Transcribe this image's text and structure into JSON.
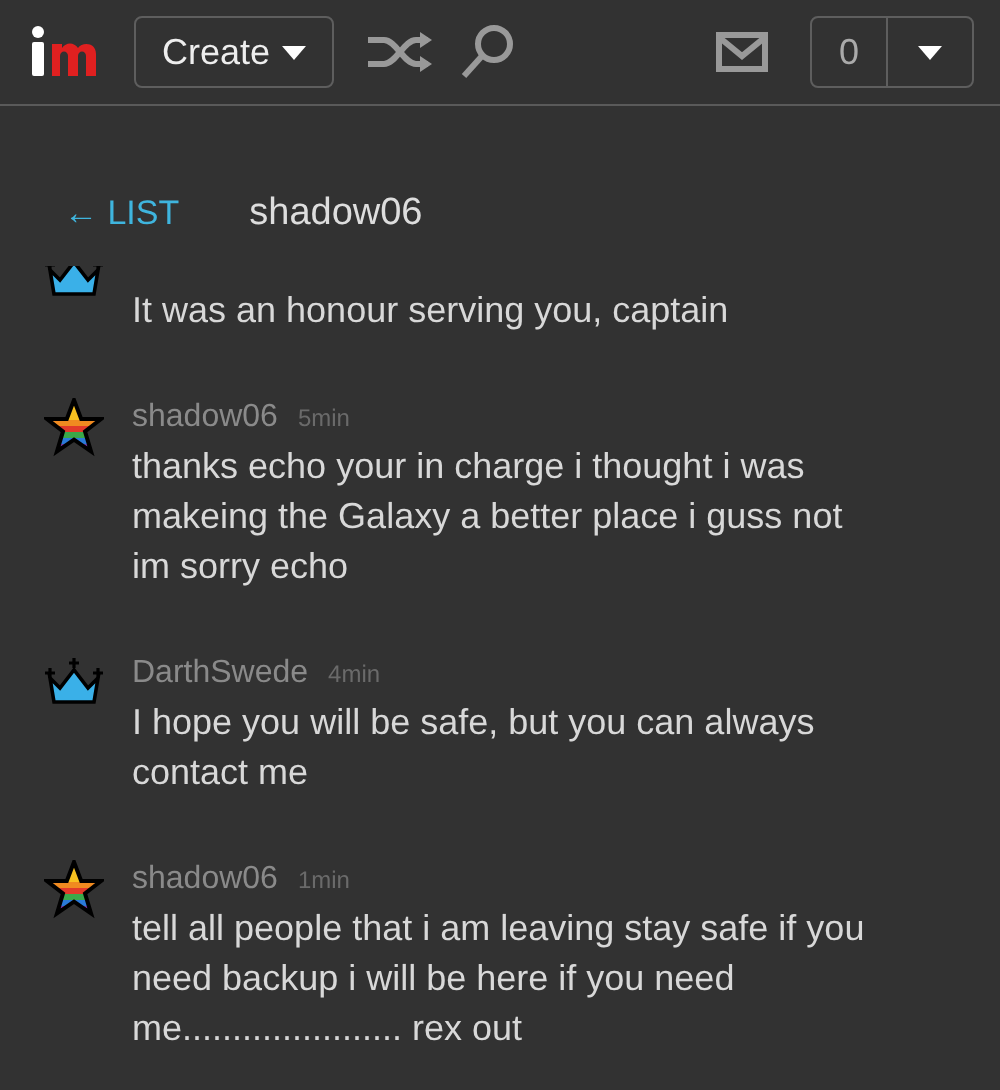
{
  "topbar": {
    "create_label": "Create",
    "notification_count": "0"
  },
  "conversation": {
    "back_link": "← LIST",
    "partner": "shadow06"
  },
  "messages": [
    {
      "kind": "crown",
      "lines": [
        "It was an honour serving you, captain"
      ]
    },
    {
      "kind": "star",
      "author": "shadow06",
      "time": "5min",
      "lines": [
        "thanks echo your in charge i thought i was",
        "makeing the Galaxy a better place i guss not",
        "im sorry echo"
      ]
    },
    {
      "kind": "crown",
      "author": "DarthSwede",
      "time": "4min",
      "lines": [
        "I hope you will be safe, but you can always",
        "contact me"
      ]
    },
    {
      "kind": "star",
      "author": "shadow06",
      "time": "1min",
      "lines": [
        "tell all people that i am leaving stay safe if you",
        "need backup i will be here if you need",
        "me...................... rex out"
      ]
    }
  ]
}
